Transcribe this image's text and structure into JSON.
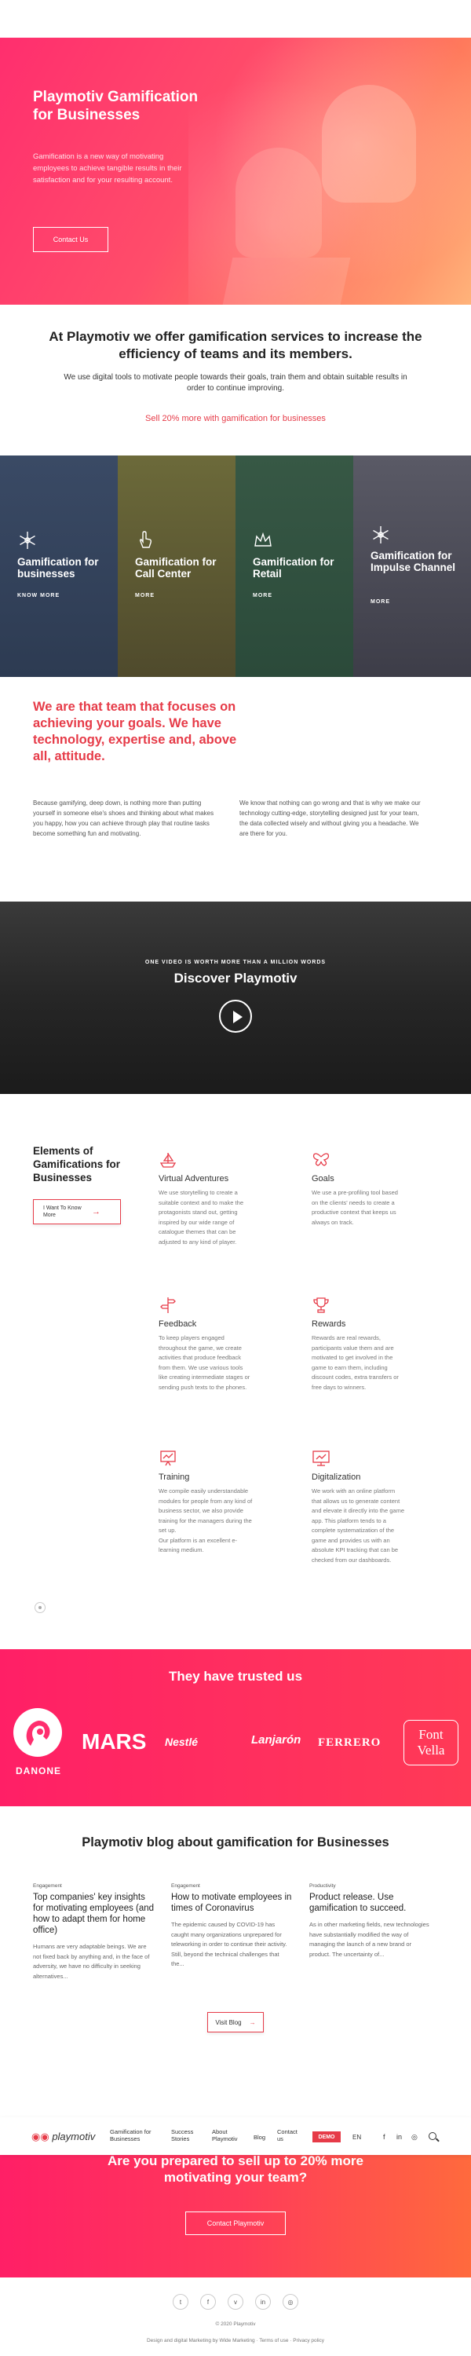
{
  "hero": {
    "title": "Playmotiv Gamification for Businesses",
    "text": "Gamification is a new way of motivating employees to achieve tangible results in their satisfaction and for your resulting account.",
    "button": "Contact Us"
  },
  "intro": {
    "title": "At Playmotiv we offer gamification services to increase the efficiency of teams and its members.",
    "text": "We use digital tools to motivate people towards their goals, train them and obtain suitable results in order to continue improving.",
    "accent": "Sell 20% more with gamification for businesses"
  },
  "cards": [
    {
      "title": "Gamification for businesses",
      "more": "KNOW MORE",
      "icon": "snowflake-icon"
    },
    {
      "title": "Gamification for Call Center",
      "more": "MORE",
      "icon": "hand-pointer-icon"
    },
    {
      "title": "Gamification for Retail",
      "more": "MORE",
      "icon": "crown-icon"
    },
    {
      "title": "Gamification for Impulse Channel",
      "more": "MORE",
      "icon": "snowflake-icon"
    }
  ],
  "team": {
    "title": "We are that team that focuses on achieving your goals. We have technology, expertise and, above all, attitude.",
    "left": "Because gamifying, deep down, is nothing more than putting yourself in someone else's shoes and thinking about what makes you happy, how you can achieve through play that routine tasks become something fun and motivating.",
    "right": "We know that nothing can go wrong and that is why we make our technology cutting-edge, storytelling designed just for your team, the data collected wisely and without giving you a headache. We are there for you."
  },
  "video": {
    "eyebrow": "ONE VIDEO IS WORTH MORE THAN A MILLION WORDS",
    "title": "Discover Playmotiv"
  },
  "elements": {
    "title": "Elements of Gamifications for Businesses",
    "button": "I Want To Know More",
    "items": [
      {
        "title": "Virtual Adventures",
        "text": "We use storytelling to create a suitable context and to make the protagonists stand out, getting inspired by our wide range of catalogue themes that can be adjusted to any kind of player.",
        "icon": "ship-icon"
      },
      {
        "title": "Goals",
        "text": "We use a pre-profiling tool based on the clients' needs to create a productive context that keeps us always on track.",
        "icon": "butterfly-icon"
      },
      {
        "title": "Feedback",
        "text": "To keep players engaged throughout the game, we create activities that produce feedback from them. We use various tools like creating intermediate stages or sending push texts to the phones.",
        "icon": "signpost-icon"
      },
      {
        "title": "Rewards",
        "text": "Rewards are real rewards, participants value them and are motivated to get involved in the game to earn them, including discount codes, extra transfers or free days to winners.",
        "icon": "trophy-icon"
      },
      {
        "title": "Training",
        "text": "We compile easily understandable modules for people from any kind of business sector, we also provide training for the managers during the set up.\nOur platform is an excellent e-learning medium.",
        "icon": "presentation-icon"
      },
      {
        "title": "Digitalization",
        "text": "We work with an online platform that allows us to generate content and elevate it directly into the game app. This platform tends to a complete systematization of the game and provides us with an absolute KPI tracking that can be checked from our dashboards.",
        "icon": "monitor-icon"
      }
    ]
  },
  "trusted": {
    "title": "They have trusted us",
    "logos": [
      "DANONE",
      "MARS",
      "Nestlé",
      "Lanjarón",
      "FERRERO",
      "Font Vella"
    ]
  },
  "blog": {
    "title": "Playmotiv blog about gamification for Businesses",
    "posts": [
      {
        "category": "Engagement",
        "title": "Top companies' key insights for motivating employees (and how to adapt them for home office)",
        "excerpt": "Humans are very adaptable beings. We are not fixed back by anything and, in the face of adversity, we have no difficulty in seeking alternatives..."
      },
      {
        "category": "Engagement",
        "title": "How to motivate employees in times of Coronavirus",
        "excerpt": "The epidemic caused by COVID-19 has caught many organizations unprepared for teleworking in order to continue their activity. Still, beyond the technical challenges that the..."
      },
      {
        "category": "Productivity",
        "title": "Product release. Use gamification to succeed.",
        "excerpt": "As in other marketing fields, new technologies have substantially modified the way of managing the launch of a new brand or product. The uncertainty of..."
      }
    ],
    "button": "Visit Blog"
  },
  "nav": {
    "logo": "playmotiv",
    "items": [
      "Gamification for Businesses",
      "Success Stories",
      "About Playmotiv",
      "Blog",
      "Contact us"
    ],
    "demo": "DEMO",
    "lang": "EN",
    "social": [
      "f",
      "in",
      "◎"
    ]
  },
  "cta": {
    "title": "Are you prepared to sell up to 20% more motivating your team?",
    "button": "Contact Playmotiv"
  },
  "footer": {
    "social": [
      "t",
      "f",
      "v",
      "in",
      "◎"
    ],
    "copy": "© 2020 Playmotiv",
    "credit": "Design and digital Marketing by Wide Marketing · Terms of use · Privacy policy"
  },
  "colors": {
    "accent": "#e63b48",
    "pink": "#ff2e6e",
    "orange": "#ff6a3d"
  }
}
